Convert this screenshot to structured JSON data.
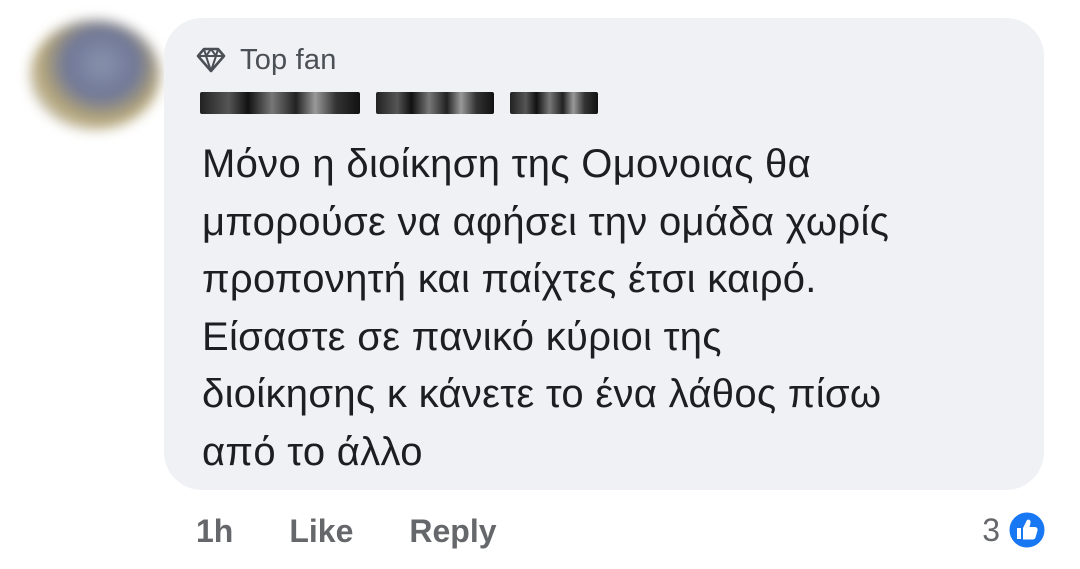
{
  "comment": {
    "badge": "Top fan",
    "badge_icon": "diamond-icon",
    "text": "Μόνο η διοίκηση της Ομονοιας θα\nμπορούσε να αφήσει την ομάδα χωρίς\nπροπονητή και παίχτες έτσι καιρό.\nΕίσαστε σε πανικό κύριοι της\nδιοίκησης κ κάνετε το ένα λάθος πίσω\nαπό το άλλο",
    "bubble_color": "#eff1f4",
    "text_color": "#1c1e21"
  },
  "actions": {
    "time": "1h",
    "like_label": "Like",
    "reply_label": "Reply",
    "color": "#65676b"
  },
  "reactions": {
    "count": "3",
    "icon": "like-reaction-icon",
    "color": "#1877f2"
  }
}
